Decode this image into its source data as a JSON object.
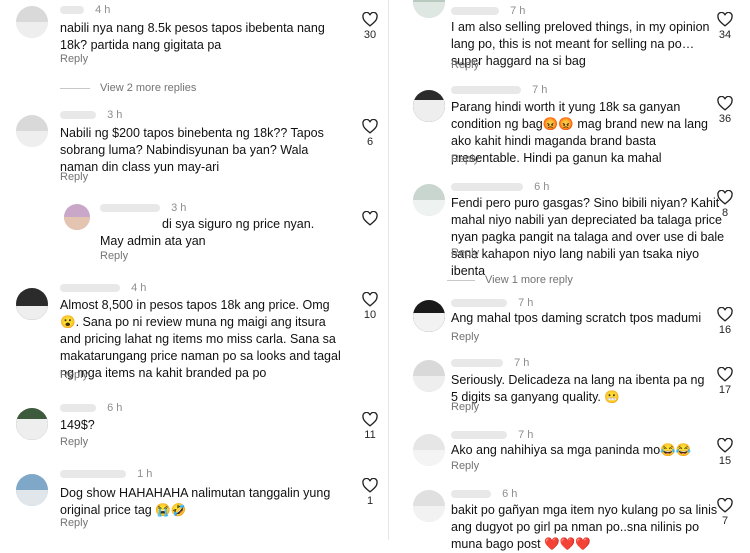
{
  "left": [
    {
      "username": "...",
      "time": "4 h",
      "text": "nabili nya nang 8.5k pesos tapos ibebenta nang 18k? partida nang gigitata pa",
      "reply": "Reply",
      "likes": "30"
    },
    {
      "view_replies": "View 2 more replies"
    },
    {
      "username": "",
      "time": "3 h",
      "text": "Nabili ng $200 tapos binebenta ng 18k?? Tapos sobrang luma? Nabindisyunan ba yan? Wala naman din class yun may-ari",
      "reply": "Reply",
      "likes": "6"
    },
    {
      "username": "",
      "time": "3 h",
      "text": "di sya siguro ng price nyan. May admin ata yan",
      "reply": "Reply",
      "likes": ""
    },
    {
      "username": "",
      "time": "4 h",
      "text": "Almost 8,500 in pesos tapos 18k ang price. Omg😮. Sana po ni review muna ng maigi ang itsura and pricing lahat ng items mo miss carla. Sana sa makatarungang price naman po sa looks and tagal ng mga items na kahit branded pa po",
      "reply": "Reply",
      "likes": "10"
    },
    {
      "username": "",
      "time": "6 h",
      "text": "149$?",
      "reply": "Reply",
      "likes": "11"
    },
    {
      "username": "",
      "time": "1 h",
      "text": "Dog show HAHAHAHA nalimutan tanggalin yung original price tag 😭🤣",
      "reply": "Reply",
      "likes": "1"
    }
  ],
  "right": [
    {
      "username": "",
      "time": "7 h",
      "text": "I am also selling preloved things, in my opinion lang po, this is not meant for selling na po… super haggard na si bag",
      "reply": "Reply",
      "likes": "34"
    },
    {
      "username": "",
      "time": "7 h",
      "text": "Parang hindi worth it yung 18k sa ganyan condition ng bag😡😡 mag brand new na lang ako kahit hindi maganda brand basta presentable. Hindi pa ganun ka mahal",
      "reply": "Reply",
      "likes": "36"
    },
    {
      "username": "",
      "time": "6 h",
      "text": "Fendi pero puro gasgas? Sino bibili niyan? Kahit mahal niyo nabili yan depreciated ba talaga price nyan pagka pangit na talaga and over use di bale sana kahapon niyo lang nabili yan tsaka niyo ibenta",
      "reply": "Reply",
      "likes": "8"
    },
    {
      "view_replies": "View 1 more reply"
    },
    {
      "username": "",
      "time": "7 h",
      "text": "Ang mahal tpos daming scratch tpos madumi",
      "reply": "Reply",
      "likes": "16"
    },
    {
      "username": "",
      "time": "7 h",
      "text": "Seriously. Delicadeza na lang na ibenta pa ng 5 digits sa ganyang quality. 😬",
      "reply": "Reply",
      "likes": "17"
    },
    {
      "username": "",
      "time": "7 h",
      "text": "Ako ang nahihiya sa mga paninda mo😂😂",
      "reply": "Reply",
      "likes": "15"
    },
    {
      "username": "",
      "time": "6 h",
      "text": "bakit po gañyan mga item nyo kulang po sa linis ang dugyot po girl pa nman po..sna nilinis po muna bago post ❤️❤️❤️",
      "reply": "",
      "likes": "7"
    }
  ]
}
